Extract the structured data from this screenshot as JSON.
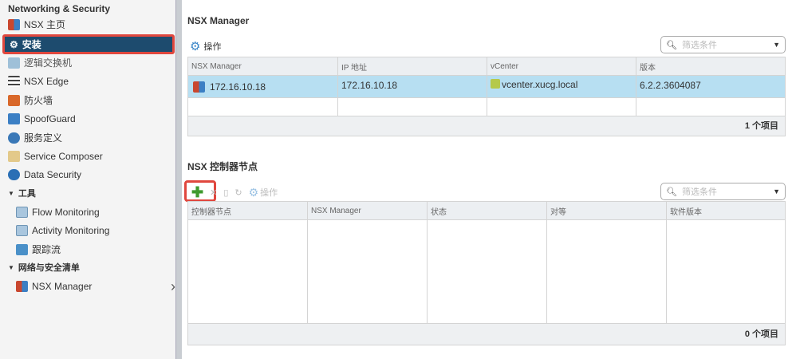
{
  "sidebar": {
    "header": "Networking & Security",
    "items": [
      {
        "label": "NSX 主页",
        "icon": "nsx-home-icon",
        "color": "#c9472f"
      },
      {
        "label": "安装",
        "icon": "gear-icon",
        "selected": true
      },
      {
        "label": "逻辑交换机",
        "icon": "logical-switch-icon",
        "color": "#7aa7c7"
      },
      {
        "label": "NSX Edge",
        "icon": "edge-icon",
        "color": "#444"
      },
      {
        "label": "防火墙",
        "icon": "firewall-icon",
        "color": "#d9682a"
      },
      {
        "label": "SpoofGuard",
        "icon": "spoofguard-icon",
        "color": "#3b7fc4"
      },
      {
        "label": "服务定义",
        "icon": "service-definition-icon",
        "color": "#3a78b7"
      },
      {
        "label": "Service Composer",
        "icon": "service-composer-icon",
        "color": "#d9b76a"
      },
      {
        "label": "Data Security",
        "icon": "data-security-icon",
        "color": "#2a6fb5"
      }
    ],
    "tools_section": "工具",
    "tools": [
      {
        "label": "Flow Monitoring",
        "icon": "flow-monitoring-icon"
      },
      {
        "label": "Activity Monitoring",
        "icon": "activity-monitoring-icon"
      },
      {
        "label": "跟踪流",
        "icon": "traceflow-icon"
      }
    ],
    "inventory_section": "网络与安全清单",
    "inventory": [
      {
        "label": "NSX Manager",
        "icon": "nsx-manager-icon"
      }
    ],
    "chevron": "›"
  },
  "manager": {
    "title": "NSX Manager",
    "actions_label": "操作",
    "search_placeholder": "筛选条件",
    "columns": [
      "NSX Manager",
      "IP 地址",
      "vCenter",
      "版本"
    ],
    "rows": [
      [
        "172.16.10.18",
        "172.16.10.18",
        "vcenter.xucg.local",
        "6.2.2.3604087"
      ]
    ],
    "footer": "1 个项目"
  },
  "controllers": {
    "title": "NSX 控制器节点",
    "actions_label": "操作",
    "search_placeholder": "筛选条件",
    "columns": [
      "控制器节点",
      "NSX Manager",
      "状态",
      "对等",
      "软件版本"
    ],
    "footer": "0 个项目"
  },
  "colors": {
    "selected": "#1d4b6e",
    "highlight_border": "#e0473e",
    "row_selected": "#b7dff2"
  }
}
